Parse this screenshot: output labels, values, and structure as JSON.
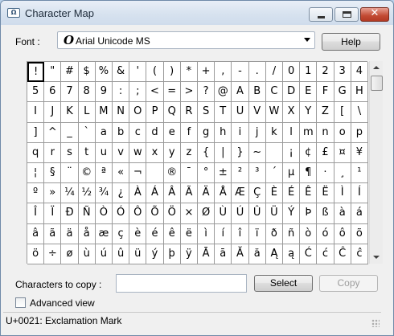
{
  "window": {
    "title": "Character Map",
    "icon": "character-map-icon"
  },
  "font": {
    "label": "Font :",
    "value": "Arial Unicode MS",
    "icon": "opentype-font-icon"
  },
  "help_label": "Help",
  "grid": {
    "selected": "!",
    "rows": [
      [
        "!",
        "\"",
        "#",
        "$",
        "%",
        "&",
        "'",
        "(",
        ")",
        "*",
        "+",
        ",",
        "-",
        ".",
        "/",
        "0",
        "1",
        "2",
        "3",
        "4"
      ],
      [
        "5",
        "6",
        "7",
        "8",
        "9",
        ":",
        ";",
        "<",
        "=",
        ">",
        "?",
        "@",
        "A",
        "B",
        "C",
        "D",
        "E",
        "F",
        "G",
        "H"
      ],
      [
        "I",
        "J",
        "K",
        "L",
        "M",
        "N",
        "O",
        "P",
        "Q",
        "R",
        "S",
        "T",
        "U",
        "V",
        "W",
        "X",
        "Y",
        "Z",
        "[",
        "\\"
      ],
      [
        "]",
        "^",
        "_",
        "`",
        "a",
        "b",
        "c",
        "d",
        "e",
        "f",
        "g",
        "h",
        "i",
        "j",
        "k",
        "l",
        "m",
        "n",
        "o",
        "p"
      ],
      [
        "q",
        "r",
        "s",
        "t",
        "u",
        "v",
        "w",
        "x",
        "y",
        "z",
        "{",
        "|",
        "}",
        "~",
        " ",
        "¡",
        "¢",
        "£",
        "¤",
        "¥"
      ],
      [
        "¦",
        "§",
        "¨",
        "©",
        "ª",
        "«",
        "¬",
        "­",
        "®",
        "¯",
        "°",
        "±",
        "²",
        "³",
        "´",
        "µ",
        "¶",
        "·",
        "¸",
        "¹"
      ],
      [
        "º",
        "»",
        "¼",
        "½",
        "¾",
        "¿",
        "À",
        "Á",
        "Â",
        "Ã",
        "Ä",
        "Å",
        "Æ",
        "Ç",
        "È",
        "É",
        "Ê",
        "Ë",
        "Ì",
        "Í"
      ],
      [
        "Î",
        "Ï",
        "Ð",
        "Ñ",
        "Ò",
        "Ó",
        "Ô",
        "Õ",
        "Ö",
        "×",
        "Ø",
        "Ù",
        "Ú",
        "Û",
        "Ü",
        "Ý",
        "Þ",
        "ß",
        "à",
        "á"
      ],
      [
        "â",
        "ã",
        "ä",
        "å",
        "æ",
        "ç",
        "è",
        "é",
        "ê",
        "ë",
        "ì",
        "í",
        "î",
        "ï",
        "ð",
        "ñ",
        "ò",
        "ó",
        "ô",
        "õ"
      ],
      [
        "ö",
        "÷",
        "ø",
        "ù",
        "ú",
        "û",
        "ü",
        "ý",
        "þ",
        "ÿ",
        "Ā",
        "ā",
        "Ă",
        "ă",
        "Ą",
        "ą",
        "Ć",
        "ć",
        "Ĉ",
        "ĉ"
      ]
    ]
  },
  "copy": {
    "label": "Characters to copy :",
    "value": "",
    "select_label": "Select",
    "copy_label": "Copy"
  },
  "advanced": {
    "label": "Advanced view",
    "checked": false
  },
  "status": "U+0021: Exclamation Mark"
}
